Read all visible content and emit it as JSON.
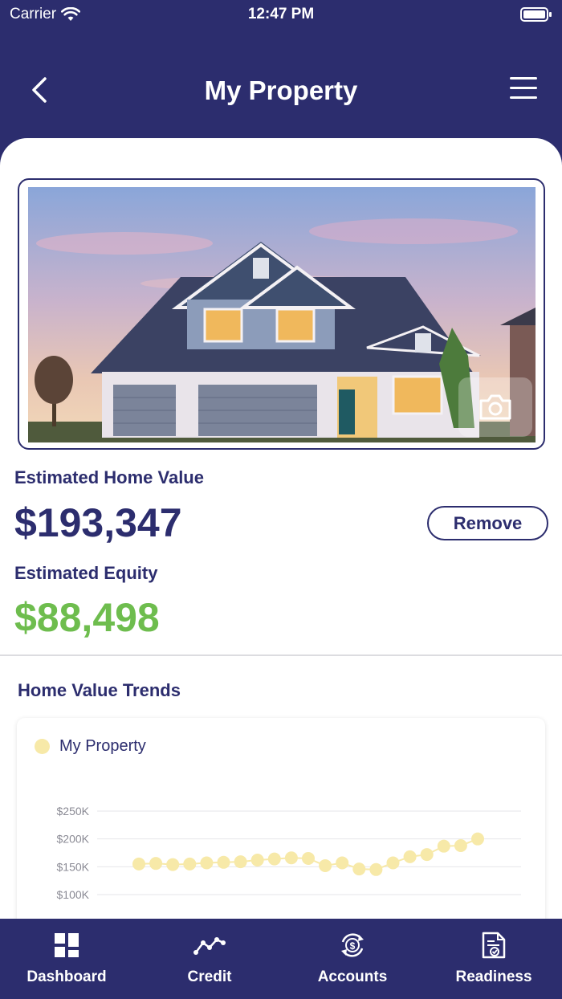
{
  "status_bar": {
    "carrier": "Carrier",
    "time": "12:47 PM"
  },
  "header": {
    "title": "My Property"
  },
  "property": {
    "home_value_label": "Estimated Home Value",
    "home_value": "$193,347",
    "remove_label": "Remove",
    "equity_label": "Estimated Equity",
    "equity": "$88,498"
  },
  "trends": {
    "title": "Home Value Trends"
  },
  "chart_data": {
    "type": "line",
    "series": [
      {
        "name": "My Property",
        "color": "#f7e9a8",
        "values": [
          155000,
          156000,
          154000,
          155000,
          157000,
          158000,
          159000,
          162000,
          164000,
          166000,
          165000,
          152000,
          157000,
          146000,
          145000,
          157000,
          168000,
          172000,
          187000,
          188000,
          200000
        ]
      }
    ],
    "y_ticks": [
      "$250K",
      "$200K",
      "$150K",
      "$100K"
    ],
    "ylim": [
      0,
      250000
    ],
    "grid": true,
    "legend_position": "top-left"
  },
  "colors": {
    "brand": "#2c2d6e",
    "equity": "#6ebd4e",
    "series": "#f7e9a8"
  },
  "tabs": [
    {
      "label": "Dashboard",
      "icon": "dashboard-icon"
    },
    {
      "label": "Credit",
      "icon": "credit-trend-icon"
    },
    {
      "label": "Accounts",
      "icon": "accounts-dollar-icon"
    },
    {
      "label": "Readiness",
      "icon": "readiness-document-icon"
    }
  ]
}
